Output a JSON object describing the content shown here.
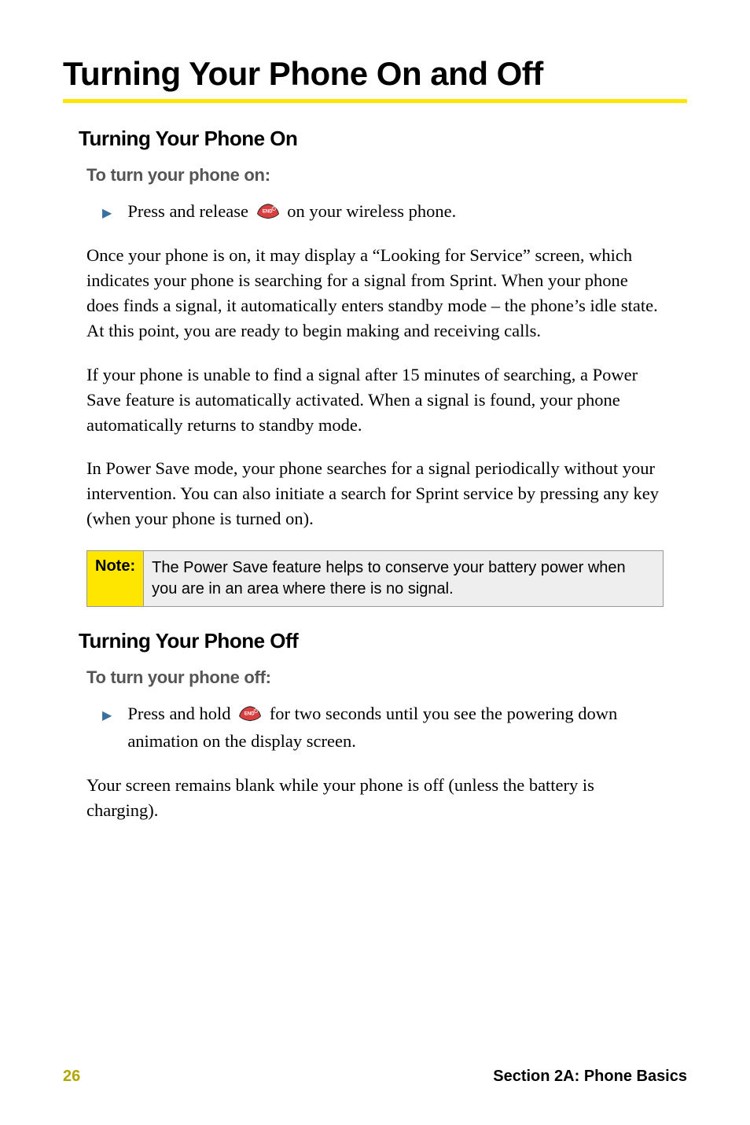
{
  "main_title": "Turning Your Phone On and Off",
  "section_on": {
    "heading": "Turning Your Phone On",
    "lead": "To turn your phone on:",
    "bullet_pre": "Press and release ",
    "bullet_post": " on your wireless phone.",
    "para1": "Once your phone is on, it may display a “Looking for Service” screen, which indicates your phone is searching for a signal from Sprint. When your phone does finds a signal, it automatically enters standby mode – the phone’s idle state. At this point, you are ready to begin making and receiving calls.",
    "para2": "If your phone is unable to find a signal after 15 minutes of searching, a Power Save feature is automatically activated. When a signal is found, your phone automatically returns to standby mode.",
    "para3": "In Power Save mode, your phone searches for a signal periodically without your intervention. You can also initiate a search for Sprint service by pressing any key (when your phone is turned on)."
  },
  "note": {
    "label": "Note:",
    "body": "The Power Save feature helps to conserve your battery power when you are in an area where there is no signal."
  },
  "section_off": {
    "heading": "Turning Your Phone Off",
    "lead": "To turn your phone off:",
    "bullet_pre": "Press and hold ",
    "bullet_post": " for two seconds until you see the powering down animation on the display screen.",
    "para1": "Your screen remains blank while your phone is off (unless the battery is charging)."
  },
  "footer": {
    "page": "26",
    "section": "Section 2A: Phone Basics"
  },
  "icons": {
    "end_key": "END"
  }
}
